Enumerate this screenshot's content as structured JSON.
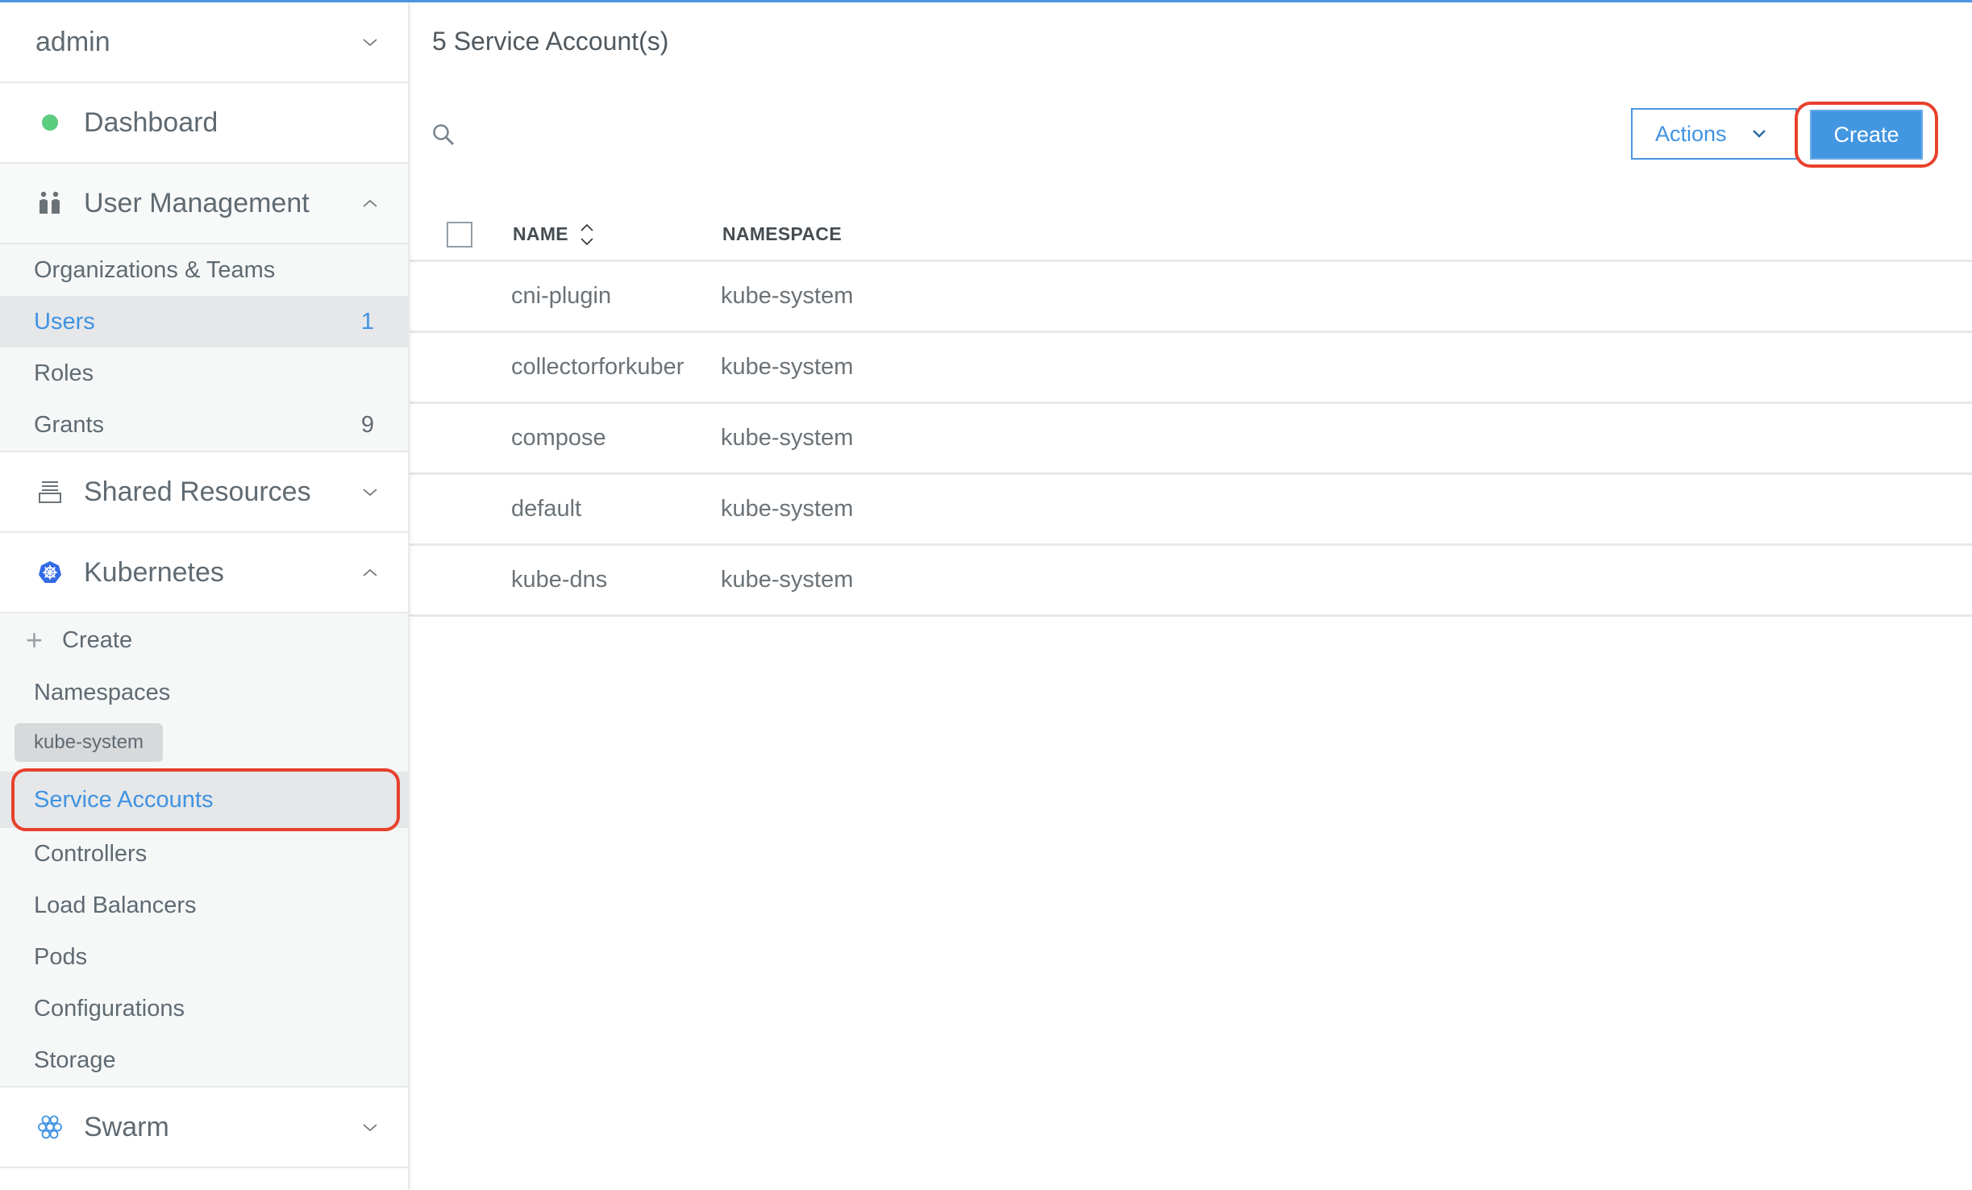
{
  "sidebar": {
    "user": "admin",
    "dashboard": "Dashboard",
    "user_management": {
      "label": "User Management",
      "items": [
        {
          "label": "Organizations & Teams",
          "count": ""
        },
        {
          "label": "Users",
          "count": "1"
        },
        {
          "label": "Roles",
          "count": ""
        },
        {
          "label": "Grants",
          "count": "9"
        }
      ]
    },
    "shared_resources": "Shared Resources",
    "kubernetes": {
      "label": "Kubernetes",
      "create": "Create",
      "namespaces": "Namespaces",
      "namespace_chip": "kube-system",
      "items": [
        {
          "label": "Service Accounts"
        },
        {
          "label": "Controllers"
        },
        {
          "label": "Load Balancers"
        },
        {
          "label": "Pods"
        },
        {
          "label": "Configurations"
        },
        {
          "label": "Storage"
        }
      ]
    },
    "swarm": "Swarm"
  },
  "main": {
    "title": "5 Service Account(s)",
    "actions_label": "Actions",
    "create_label": "Create",
    "columns": [
      "NAME",
      "NAMESPACE"
    ],
    "rows": [
      {
        "name": "cni-plugin",
        "namespace": "kube-system"
      },
      {
        "name": "collectorforkuber",
        "namespace": "kube-system"
      },
      {
        "name": "compose",
        "namespace": "kube-system"
      },
      {
        "name": "default",
        "namespace": "kube-system"
      },
      {
        "name": "kube-dns",
        "namespace": "kube-system"
      }
    ]
  },
  "colors": {
    "accent": "#4396e0",
    "highlight": "#e8412c",
    "status_green": "#5ccc7f",
    "kubernetes_blue": "#326ce5"
  }
}
